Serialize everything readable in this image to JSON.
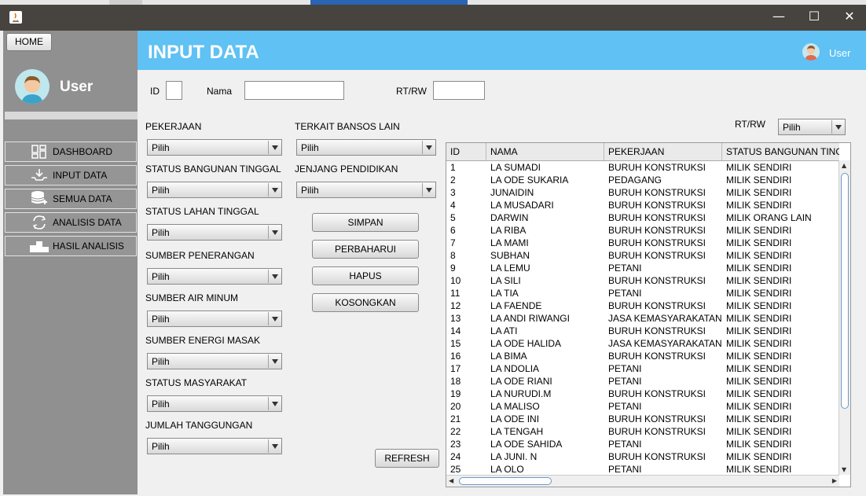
{
  "window": {
    "minimize": "—",
    "maximize": "☐",
    "close": "✕"
  },
  "sidebar": {
    "home_label": "HOME",
    "user_label": "User",
    "items": [
      {
        "label": "DASHBOARD",
        "icon": "dashboard-icon"
      },
      {
        "label": "INPUT DATA",
        "icon": "input-data-icon"
      },
      {
        "label": "SEMUA DATA",
        "icon": "database-add-icon"
      },
      {
        "label": "ANALISIS DATA",
        "icon": "refresh-cycle-icon"
      },
      {
        "label": "HASIL ANALISIS",
        "icon": "podium-icon"
      }
    ]
  },
  "header": {
    "title": "INPUT DATA",
    "user_label": "User"
  },
  "form": {
    "id_label": "ID",
    "nama_label": "Nama",
    "rtrw_label": "RT/RW",
    "fields_left": [
      {
        "label": "PEKERJAAN",
        "value": "Pilih"
      },
      {
        "label": "STATUS BANGUNAN TINGGAL",
        "value": "Pilih"
      },
      {
        "label": "STATUS LAHAN TINGGAL",
        "value": "Pilih"
      },
      {
        "label": "SUMBER PENERANGAN",
        "value": "Pilih"
      },
      {
        "label": "SUMBER AIR MINUM",
        "value": "Pilih"
      },
      {
        "label": "SUMBER ENERGI MASAK",
        "value": "Pilih"
      },
      {
        "label": "STATUS MASYARAKAT",
        "value": "Pilih"
      },
      {
        "label": "JUMLAH TANGGUNGAN",
        "value": "Pilih"
      }
    ],
    "fields_mid": [
      {
        "label": "TERKAIT BANSOS LAIN",
        "value": "Pilih"
      },
      {
        "label": "JENJANG PENDIDIKAN",
        "value": "Pilih"
      }
    ],
    "buttons": {
      "simpan": "SIMPAN",
      "perbaharui": "PERBAHARUI",
      "hapus": "HAPUS",
      "kosongkan": "KOSONGKAN",
      "refresh": "REFRESH"
    }
  },
  "filter": {
    "label": "RT/RW",
    "value": "Pilih"
  },
  "table": {
    "columns": [
      "ID",
      "NAMA",
      "PEKERJAAN",
      "STATUS BANGUNAN TINGGAL"
    ],
    "rows": [
      [
        "1",
        "LA SUMADI",
        "BURUH KONSTRUKSI",
        "MILIK SENDIRI"
      ],
      [
        "2",
        "LA ODE SUKARIA",
        "PEDAGANG",
        "MILIK SENDIRI"
      ],
      [
        "3",
        "JUNAIDIN",
        "BURUH KONSTRUKSI",
        "MILIK SENDIRI"
      ],
      [
        "4",
        "LA MUSADARI",
        "BURUH KONSTRUKSI",
        "MILIK SENDIRI"
      ],
      [
        "5",
        "DARWIN",
        "BURUH KONSTRUKSI",
        "MILIK ORANG LAIN"
      ],
      [
        "6",
        "LA RIBA",
        "BURUH KONSTRUKSI",
        "MILIK SENDIRI"
      ],
      [
        "7",
        "LA MAMI",
        "BURUH KONSTRUKSI",
        "MILIK SENDIRI"
      ],
      [
        "8",
        "SUBHAN",
        "BURUH KONSTRUKSI",
        "MILIK SENDIRI"
      ],
      [
        "9",
        "LA LEMU",
        "PETANI",
        "MILIK SENDIRI"
      ],
      [
        "10",
        "LA SILI",
        "BURUH KONSTRUKSI",
        "MILIK SENDIRI"
      ],
      [
        "11",
        "LA TIA",
        "PETANI",
        "MILIK SENDIRI"
      ],
      [
        "12",
        "LA FAENDE",
        "BURUH KONSTRUKSI",
        "MILIK SENDIRI"
      ],
      [
        "13",
        "LA ANDI RIWANGI",
        "JASA KEMASYARAKATAN",
        "MILIK SENDIRI"
      ],
      [
        "14",
        "LA ATI",
        "BURUH KONSTRUKSI",
        "MILIK SENDIRI"
      ],
      [
        "15",
        "LA ODE HALIDA",
        "JASA KEMASYARAKATAN",
        "MILIK SENDIRI"
      ],
      [
        "16",
        "LA BIMA",
        "BURUH KONSTRUKSI",
        "MILIK SENDIRI"
      ],
      [
        "17",
        "LA NDOLIA",
        "PETANI",
        "MILIK SENDIRI"
      ],
      [
        "18",
        "LA ODE RIANI",
        "PETANI",
        "MILIK SENDIRI"
      ],
      [
        "19",
        "LA NURUDI.M",
        "BURUH KONSTRUKSI",
        "MILIK SENDIRI"
      ],
      [
        "20",
        "LA MALISO",
        "PETANI",
        "MILIK SENDIRI"
      ],
      [
        "21",
        "LA ODE INI",
        "BURUH KONSTRUKSI",
        "MILIK SENDIRI"
      ],
      [
        "22",
        "LA TENGAH",
        "BURUH KONSTRUKSI",
        "MILIK SENDIRI"
      ],
      [
        "23",
        "LA ODE SAHIDA",
        "PETANI",
        "MILIK SENDIRI"
      ],
      [
        "24",
        "LA JUNI. N",
        "BURUH KONSTRUKSI",
        "MILIK SENDIRI"
      ],
      [
        "25",
        "LA OLO",
        "PETANI",
        "MILIK SENDIRI"
      ]
    ]
  },
  "colors": {
    "header": "#5fc1f4",
    "sidebar": "#909090",
    "titlebar": "#47443f"
  }
}
